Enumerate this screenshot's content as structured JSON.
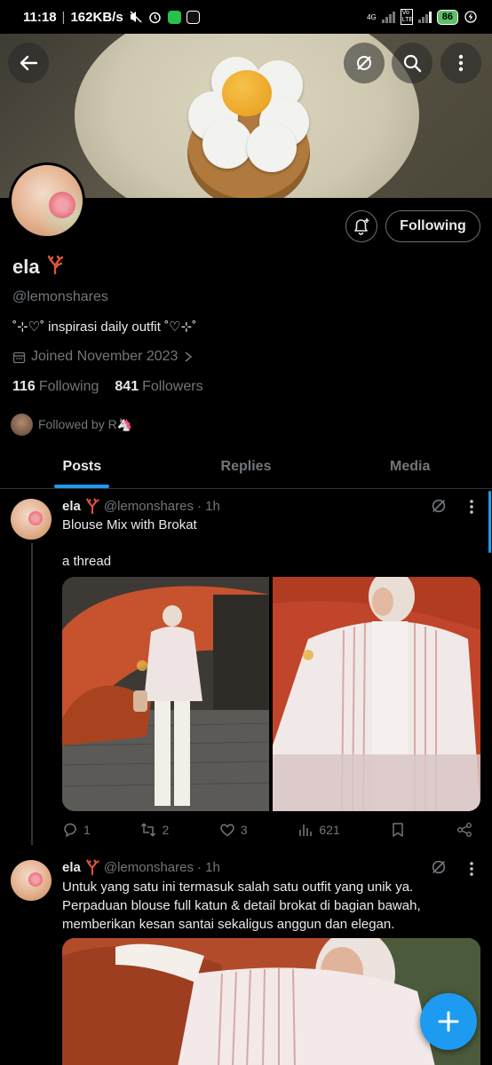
{
  "status_bar": {
    "time": "11:18",
    "speed": "162KB/s",
    "battery": "86",
    "network_label": "4G",
    "volte_label": "Vo LTE"
  },
  "profile": {
    "display_name": "ela",
    "handle": "@lemonshares",
    "bio": "˚⊹♡˚ inspirasi daily outfit ˚♡⊹˚",
    "joined": "Joined November 2023",
    "following_count": "116",
    "following_label": "Following",
    "followers_count": "841",
    "followers_label": "Followers",
    "followed_by": "Followed by R🦄",
    "follow_button_label": "Following"
  },
  "tabs": [
    {
      "label": "Posts",
      "active": true
    },
    {
      "label": "Replies",
      "active": false
    },
    {
      "label": "Media",
      "active": false
    }
  ],
  "tweets": [
    {
      "name": "ela",
      "handle": "@lemonshares",
      "time": "· 1h",
      "text_line1": "Blouse Mix with Brokat",
      "text_line2": "a thread",
      "replies": "1",
      "reposts": "2",
      "likes": "3",
      "views": "621"
    },
    {
      "name": "ela",
      "handle": "@lemonshares",
      "time": "· 1h",
      "text": "Untuk yang satu ini termasuk salah satu outfit yang unik ya. Perpaduan blouse full katun & detail brokat di bagian bawah, memberikan kesan santai sekaligus anggun dan elegan."
    }
  ],
  "colors": {
    "accent": "#1d9bf0",
    "text_primary": "#e7e9ea",
    "text_secondary": "#71767b",
    "background": "#000000"
  },
  "icons": {
    "back": "arrow-left-icon",
    "grok": "grok-icon",
    "search": "search-icon",
    "more": "more-vertical-icon",
    "notify": "bell-plus-icon",
    "calendar": "calendar-icon",
    "compose": "plus-icon"
  }
}
